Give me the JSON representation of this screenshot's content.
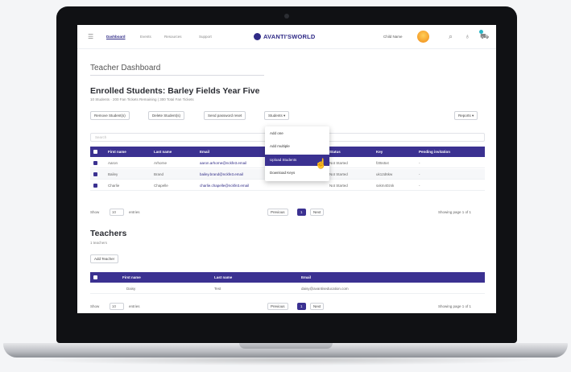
{
  "nav": {
    "links": [
      "Dashboard",
      "Events",
      "Resources",
      "Support"
    ],
    "logo": "AVANTI'SWORLD",
    "user_name": "Child Name"
  },
  "page_title": "Teacher Dashboard",
  "students": {
    "title": "Enrolled Students: Barley Fields Year Five",
    "subtitle": "10 Students · 200 Fan Tickets Remaining | 300 Total Fan Tickets",
    "buttons": {
      "remove": "Remove Student(s)",
      "delete": "Delete Student(s)",
      "password_reset": "Send password reset",
      "students_menu": "Students ▾",
      "reports": "Reports ▾"
    },
    "search_placeholder": "Search",
    "dropdown": [
      "Add one",
      "Add multiple",
      "Upload Students",
      "Download Keys"
    ],
    "columns": [
      "First name",
      "Last name",
      "Email",
      "Status",
      "Key",
      "Pending invitation"
    ],
    "rows": [
      {
        "first": "Aaron",
        "last": "Arhorne",
        "email": "aaron.arhorne@nckfe3.email",
        "status": "Not Started",
        "key": "f2t5s5xt",
        "pending": "-"
      },
      {
        "first": "Bailey",
        "last": "Brand",
        "email": "bailey.brand@nckfe3.email",
        "status": "Not Started",
        "key": "uk12d6kw",
        "pending": "-"
      },
      {
        "first": "Charlie",
        "last": "Chapelle",
        "email": "charlie.chapelle@nckfe3.email",
        "status": "Not Started",
        "key": "sxkm40zsk",
        "pending": "-"
      }
    ],
    "show_label": "Show",
    "show_value": "10",
    "entries_label": "entries",
    "pagination": {
      "previous": "Previous",
      "page": "1",
      "next": "Next"
    },
    "page_info": "Showing page 1 of 1"
  },
  "teachers": {
    "title": "Teachers",
    "subtitle": "1 teachers",
    "add_button": "Add Teacher",
    "columns": [
      "First name",
      "Last name",
      "Email"
    ],
    "rows": [
      {
        "first": "Daisy",
        "last": "Test",
        "email": "daisy@avantiseducation.com"
      }
    ],
    "show_label": "Show",
    "show_value": "10",
    "entries_label": "entries",
    "pagination": {
      "previous": "Previous",
      "page": "1",
      "next": "Next"
    },
    "page_info": "Showing page 1 of 1"
  },
  "colors": {
    "accent": "#3b3191",
    "brand": "#2f2a86",
    "avatar": "#f08a16"
  }
}
